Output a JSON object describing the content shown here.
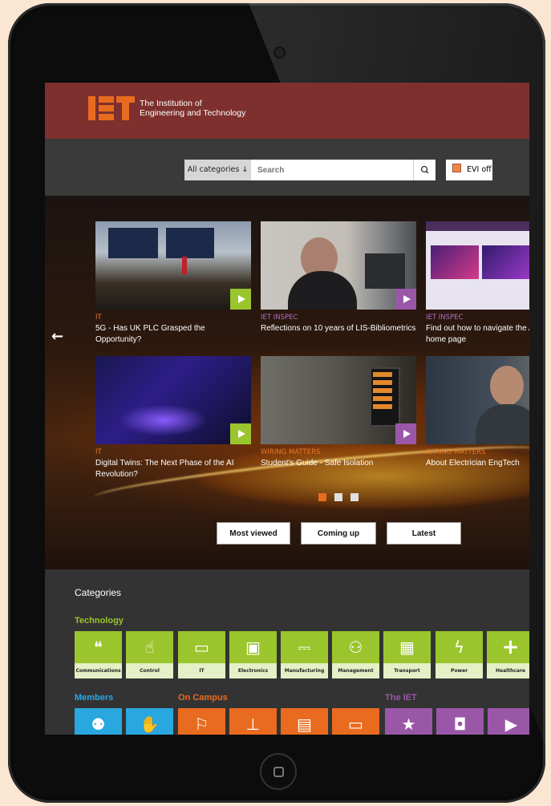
{
  "brand": {
    "line1": "The Institution of",
    "line2": "Engineering and Technology"
  },
  "search": {
    "category_label": "All categories",
    "category_arrow": "↓",
    "placeholder": "Search",
    "button_icon": "search-icon"
  },
  "evi": {
    "label": "EVI off"
  },
  "carousel": {
    "prev_icon": "←",
    "items": [
      {
        "category": "IT",
        "title": "5G - Has UK PLC Grasped the Opportunity?"
      },
      {
        "category": "IET INSPEC",
        "title": "Reflections on 10 years of LIS-Bibliometrics"
      },
      {
        "category": "IET INSPEC",
        "title": "Find out how to navigate the Analytics home page"
      },
      {
        "category": "IT",
        "title": "Digital Twins: The Next Phase of the AI Revolution?"
      },
      {
        "category": "WIRING MATTERS",
        "title": "Student's Guide - Safe Isolation"
      },
      {
        "category": "WIRING MATTERS",
        "title": "About Electrician EngTech"
      }
    ],
    "page_count": 3,
    "active_page": 1
  },
  "tabs": [
    "Most viewed",
    "Coming up",
    "Latest"
  ],
  "categories": {
    "heading": "Categories",
    "technology_label": "Technology",
    "technology": [
      "Communications",
      "Control",
      "IT",
      "Electronics",
      "Manufacturing",
      "Management",
      "Transport",
      "Power",
      "Healthcare"
    ],
    "members_label": "Members",
    "on_campus_label": "On Campus",
    "the_iet_label": "The IET"
  },
  "colors": {
    "brand_orange": "#e96b1f",
    "header": "#7d302d",
    "tech_green": "#9bc52d",
    "members_blue": "#29a8e0",
    "iet_purple": "#9a57a8"
  }
}
